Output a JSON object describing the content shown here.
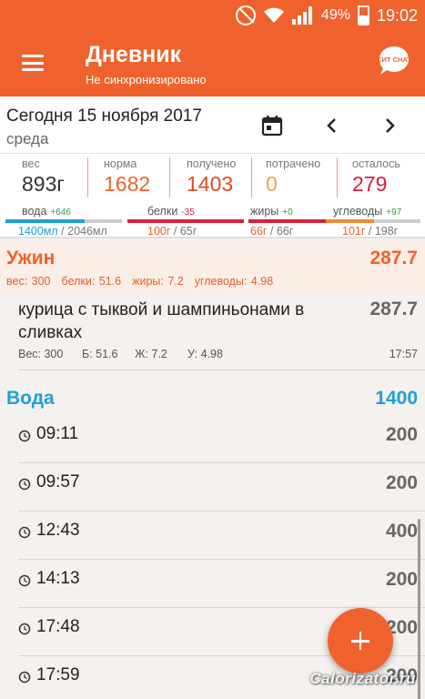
{
  "status_bar": {
    "battery": "49%",
    "time": "19:02",
    "battery_level": 0.49,
    "icons": [
      "mute-icon",
      "wifi-icon",
      "signal-icon",
      "battery-icon"
    ]
  },
  "app_bar": {
    "title": "Дневник",
    "subtitle": "Не синхронизировано",
    "icons": [
      "menu-icon",
      "chat-icon"
    ],
    "chat_icon_text": "СИТ CHAT"
  },
  "date": {
    "date": "Сегодня 15 ноября 2017",
    "weekday": "среда",
    "icons": [
      "calendar-icon",
      "chevron-left-icon",
      "chevron-right-icon"
    ]
  },
  "stats": [
    {
      "label": "вес",
      "value": "893г",
      "color": "#333333"
    },
    {
      "label": "норма",
      "value": "1682",
      "color": "#f0622d"
    },
    {
      "label": "получено",
      "value": "1403",
      "color": "#e04a20"
    },
    {
      "label": "потрачено",
      "value": "0",
      "color": "#f5a04a"
    },
    {
      "label": "осталось",
      "value": "279",
      "color": "#d8203a"
    }
  ],
  "macros": [
    {
      "name": "вода",
      "delta": "+646",
      "delta_color": "#2e9e3a",
      "value": "1400мл",
      "norm": " / 2046мл",
      "value_color": "#1f9fd9",
      "bar_color": "#1f9fd9",
      "fraction": 0.68
    },
    {
      "name": "белки",
      "delta": "-35",
      "delta_color": "#d8203a",
      "value": "100г",
      "norm": " / 65г",
      "value_color": "#f0622d",
      "bar_color": "#d8203a",
      "fraction": 1.0
    },
    {
      "name": "жиры",
      "delta": "+0",
      "delta_color": "#2e9e3a",
      "value": "66г",
      "norm": " / 66г",
      "value_color": "#f0622d",
      "bar_color": "#d8203a",
      "fraction": 1.0
    },
    {
      "name": "углеводы",
      "delta": "+97",
      "delta_color": "#2e9e3a",
      "value": "101г",
      "norm": " / 198г",
      "value_color": "#f0622d",
      "bar_color": "#f08a2d",
      "fraction": 0.51
    }
  ],
  "meal": {
    "title": "Ужин",
    "kcal": "287.7",
    "weight": "вес: 300",
    "protein": "белки: 51.6",
    "fat": "жиры: 7.2",
    "carbs": "углеводы: 4.98"
  },
  "food": {
    "name": "курица с тыквой и шампиньонами в сливках",
    "kcal": "287.7",
    "weight": "Вес: 300",
    "protein": "Б: 51.6",
    "fat": "Ж: 7.2",
    "carbs": "У: 4.98",
    "time": "17:57"
  },
  "water": {
    "title": "Вода",
    "total": "1400",
    "entries": [
      {
        "time": "09:11",
        "amount": "200"
      },
      {
        "time": "09:57",
        "amount": "200"
      },
      {
        "time": "12:43",
        "amount": "400"
      },
      {
        "time": "14:13",
        "amount": "200"
      },
      {
        "time": "17:48",
        "amount": "200"
      },
      {
        "time": "17:59",
        "amount": "200"
      }
    ]
  },
  "fab_icon": "plus-icon",
  "watermark": "Calorizator.ru"
}
